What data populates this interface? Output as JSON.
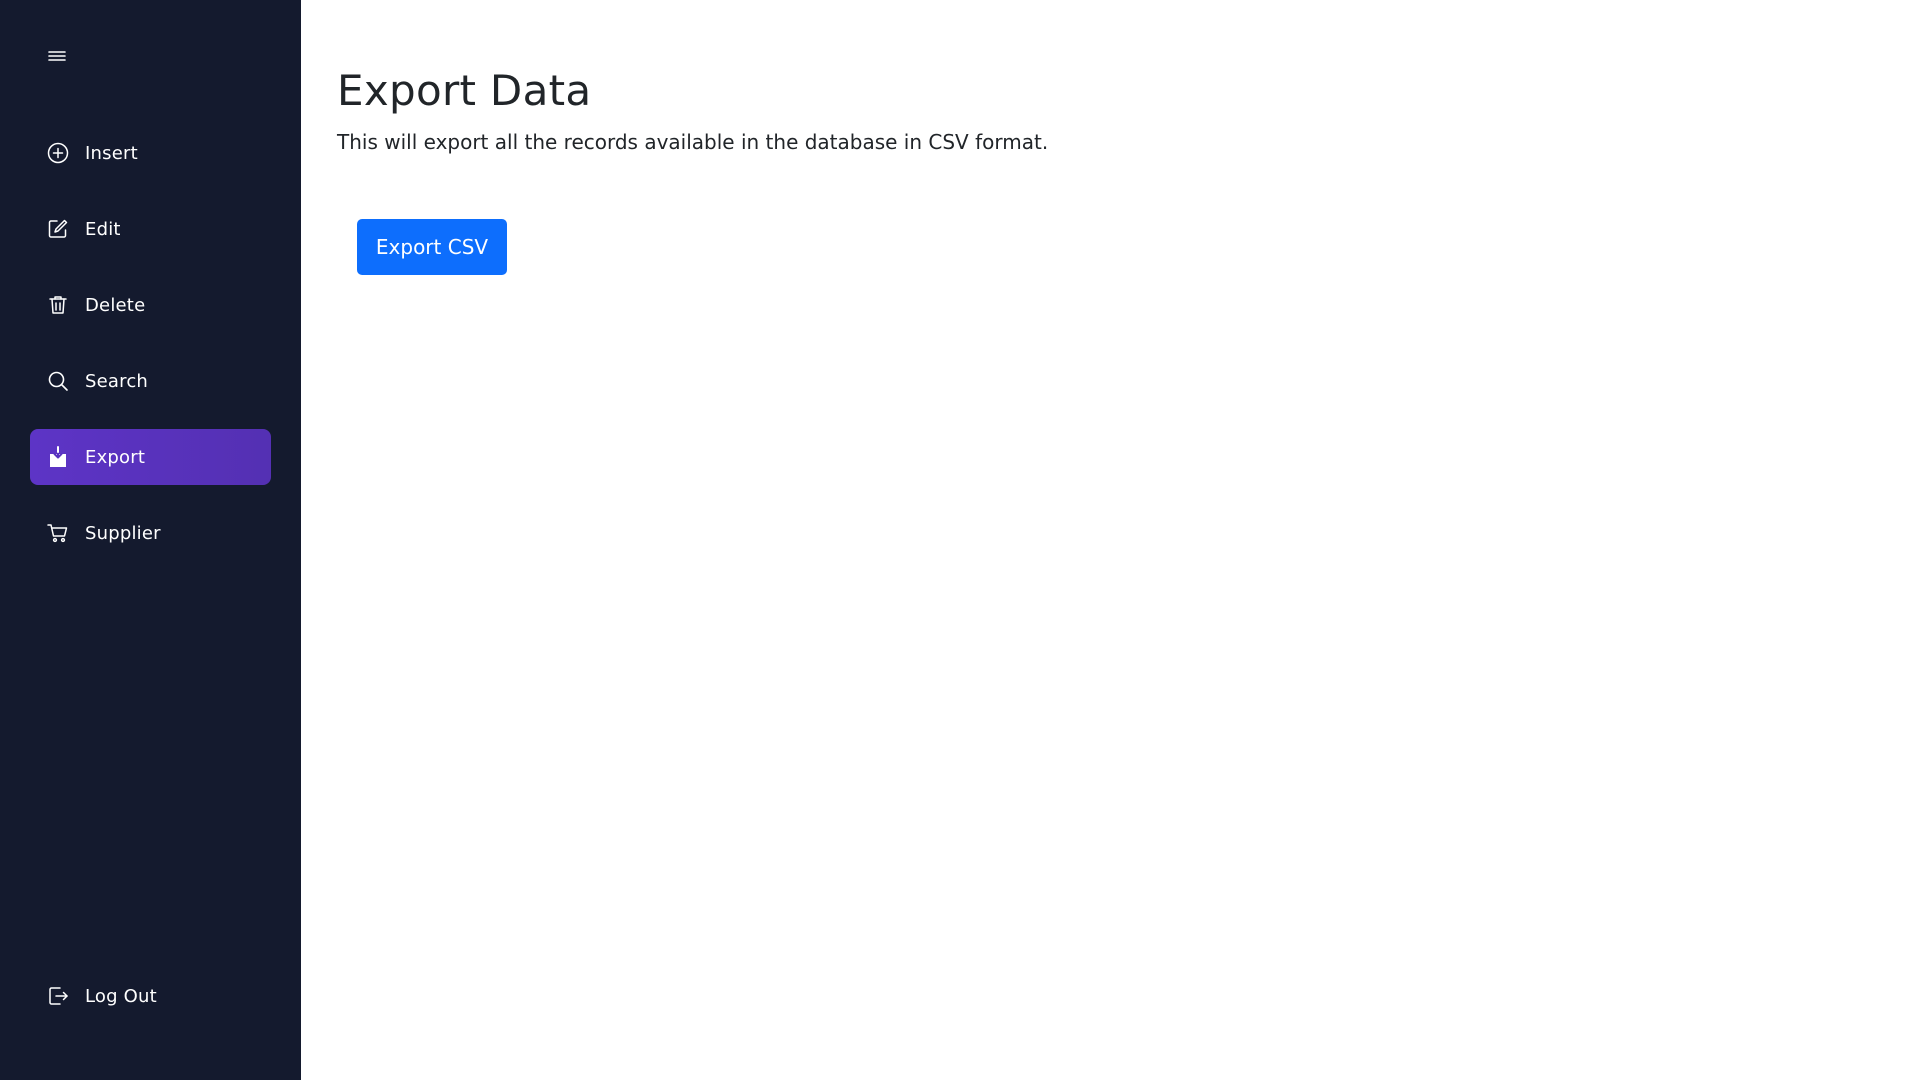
{
  "sidebar": {
    "toggle_icon": "hamburger-menu-icon",
    "items": [
      {
        "label": "Insert",
        "icon": "plus-circle-icon"
      },
      {
        "label": "Edit",
        "icon": "edit-square-icon"
      },
      {
        "label": "Delete",
        "icon": "trash-icon"
      },
      {
        "label": "Search",
        "icon": "search-icon"
      },
      {
        "label": "Export",
        "icon": "export-download-icon",
        "active": true
      },
      {
        "label": "Supplier",
        "icon": "cart-icon"
      }
    ],
    "logout": {
      "label": "Log Out",
      "icon": "logout-icon"
    },
    "background_color": "#141a2e",
    "active_color": "#5833bf"
  },
  "main": {
    "title": "Export Data",
    "description": "This will export all the records available in the database in CSV format.",
    "export_button_label": "Export CSV",
    "button_color": "#0d6efd"
  }
}
